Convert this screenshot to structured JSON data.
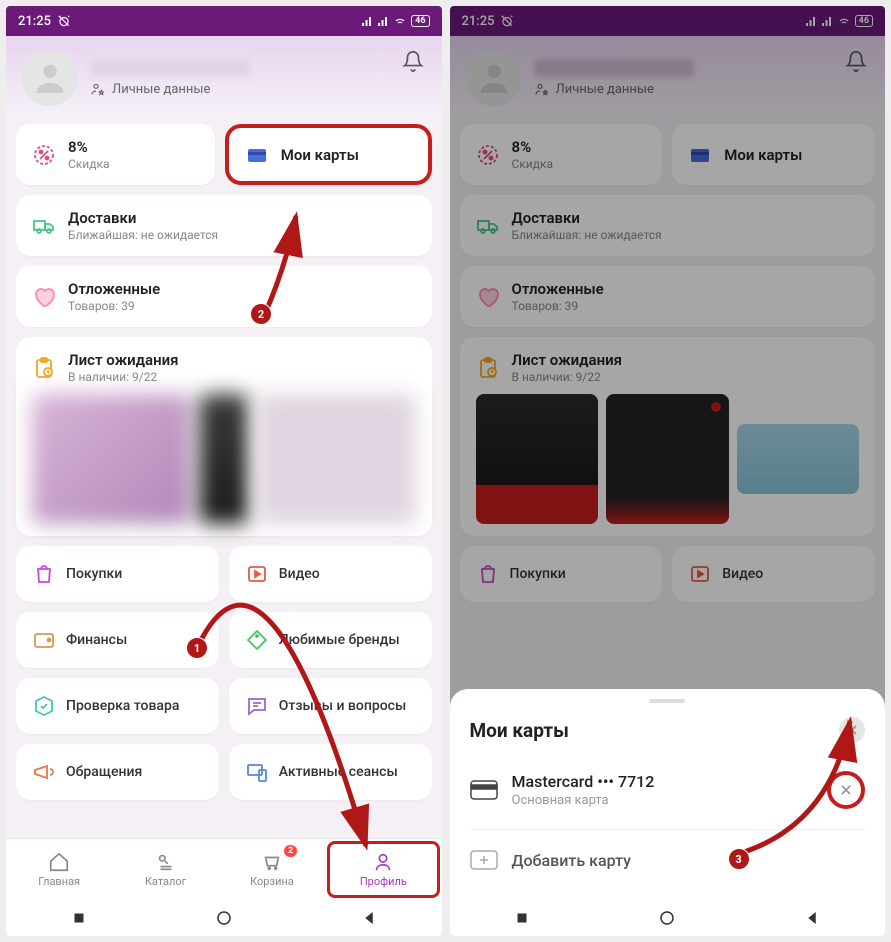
{
  "status": {
    "time": "21:25",
    "battery": "46"
  },
  "header": {
    "personal_data": "Личные данные"
  },
  "tiles": {
    "discount": {
      "title": "8%",
      "sub": "Скидка"
    },
    "cards": {
      "title": "Мои карты"
    },
    "delivery": {
      "title": "Доставки",
      "sub": "Ближайшая: не ожидается"
    },
    "favorites": {
      "title": "Отложенные",
      "sub": "Товаров: 39"
    },
    "waitlist": {
      "title": "Лист ожидания",
      "sub": "В наличии: 9/22"
    },
    "purchases": "Покупки",
    "video": "Видео",
    "finance": "Финансы",
    "brands": "Любимые бренды",
    "check": "Проверка товара",
    "reviews": "Отзывы и вопросы",
    "appeals": "Обращения",
    "sessions": "Активные сеансы"
  },
  "nav": {
    "home": "Главная",
    "catalog": "Каталог",
    "cart": "Корзина",
    "cart_badge": "2",
    "profile": "Профиль"
  },
  "sheet": {
    "title": "Мои карты",
    "card_name": "Mastercard ••• 7712",
    "card_sub": "Основная карта",
    "add": "Добавить карту"
  },
  "annotations": {
    "a1": "1",
    "a2": "2",
    "a3": "3"
  }
}
